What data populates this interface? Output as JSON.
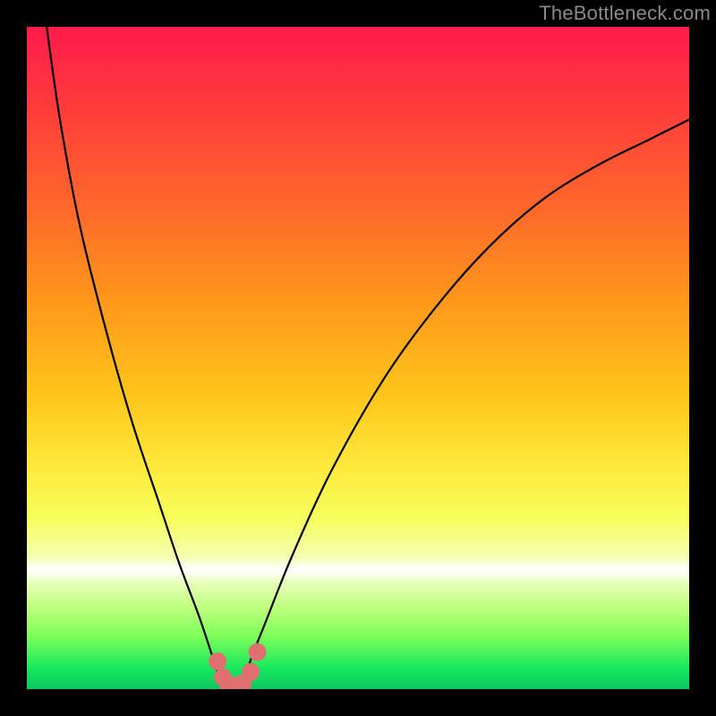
{
  "watermark": "TheBottleneck.com",
  "chart_data": {
    "type": "line",
    "title": "",
    "xlabel": "",
    "ylabel": "",
    "xlim": [
      0,
      100
    ],
    "ylim": [
      0,
      100
    ],
    "grid": false,
    "legend": null,
    "series": [
      {
        "name": "bottleneck-curve",
        "x": [
          3,
          5,
          8,
          12,
          16,
          20,
          23,
          26,
          28,
          29,
          30,
          31,
          32,
          33,
          34,
          36,
          40,
          46,
          54,
          62,
          70,
          78,
          86,
          94,
          100
        ],
        "y": [
          100,
          86,
          70,
          54,
          40,
          28,
          19,
          11,
          5,
          2,
          0.5,
          0,
          0.5,
          2,
          5,
          10,
          20,
          33,
          47,
          58,
          67,
          74,
          79,
          83,
          86
        ]
      }
    ],
    "markers": [
      {
        "name": "marker-left-upper",
        "x": 28.8,
        "y": 4.2
      },
      {
        "name": "marker-left-lower",
        "x": 29.6,
        "y": 1.8
      },
      {
        "name": "marker-bottom-left",
        "x": 30.4,
        "y": 0.7
      },
      {
        "name": "marker-bottom-mid",
        "x": 31.4,
        "y": 0.5
      },
      {
        "name": "marker-bottom-right",
        "x": 32.6,
        "y": 0.9
      },
      {
        "name": "marker-right-lower",
        "x": 33.8,
        "y": 2.6
      },
      {
        "name": "marker-right-upper",
        "x": 34.8,
        "y": 5.6
      }
    ],
    "marker_color": "#e07070",
    "curve_color": "#000000"
  }
}
